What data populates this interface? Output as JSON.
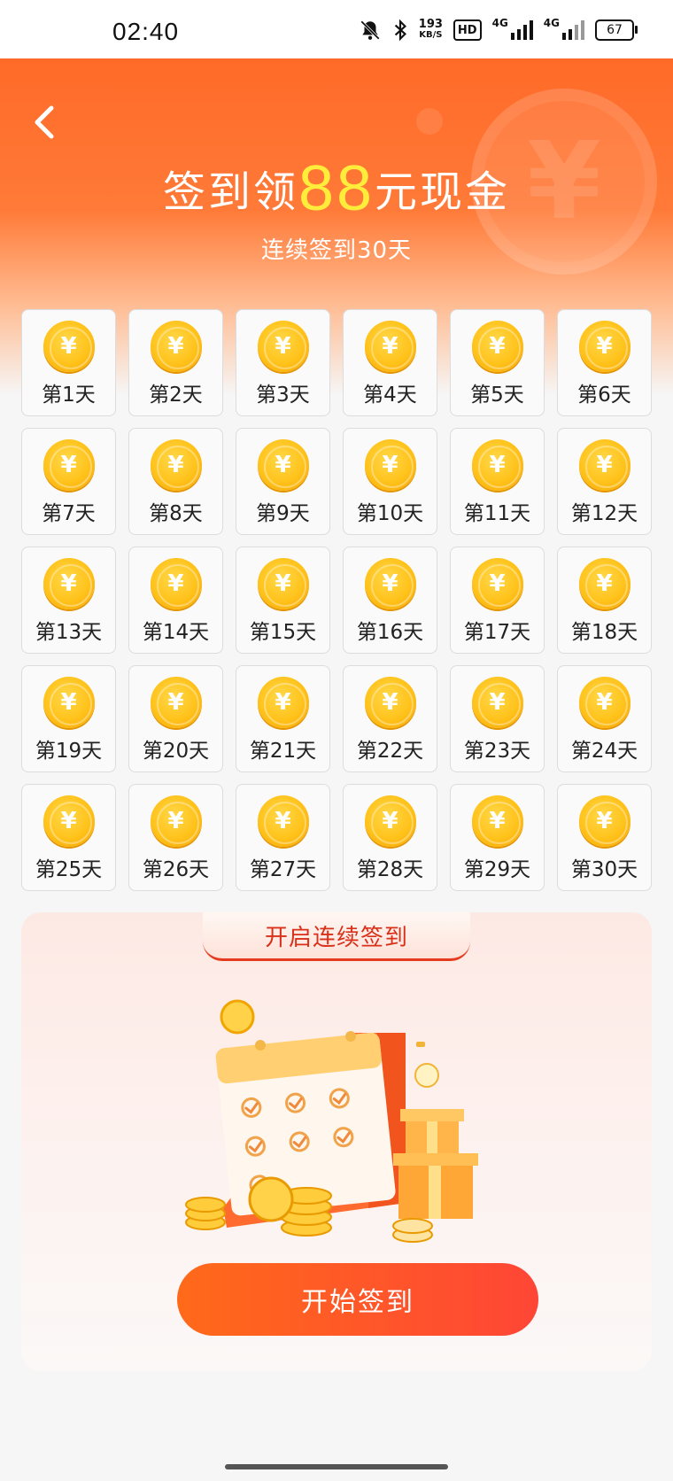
{
  "status_bar": {
    "time": "02:40",
    "speed_value": "193",
    "speed_unit": "KB/S",
    "hd_label": "HD",
    "network_1": "4G",
    "network_2": "4G",
    "battery": "67",
    "icons": [
      "mute-bell-icon",
      "bluetooth-icon",
      "signal-icon",
      "signal-icon"
    ]
  },
  "header": {
    "title_prefix": "签到领",
    "title_amount": "88",
    "title_suffix": "元现金",
    "subtitle": "连续签到30天",
    "coin_symbol": "¥",
    "colors": {
      "top": "#ff6a28",
      "amount": "#ffec3b"
    }
  },
  "days": [
    "第1天",
    "第2天",
    "第3天",
    "第4天",
    "第5天",
    "第6天",
    "第7天",
    "第8天",
    "第9天",
    "第10天",
    "第11天",
    "第12天",
    "第13天",
    "第14天",
    "第15天",
    "第16天",
    "第17天",
    "第18天",
    "第19天",
    "第20天",
    "第21天",
    "第22天",
    "第23天",
    "第24天",
    "第25天",
    "第26天",
    "第27天",
    "第28天",
    "第29天",
    "第30天"
  ],
  "coin_symbol": "¥",
  "panel": {
    "tab_label": "开启连续签到",
    "start_button": "开始签到",
    "colors": {
      "button_start": "#ff6a1a",
      "button_end": "#ff4636",
      "tab_text": "#d9301a"
    }
  }
}
